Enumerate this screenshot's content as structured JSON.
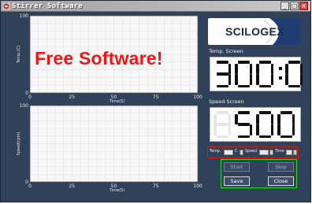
{
  "window": {
    "title": "Stirrer Software"
  },
  "titlebar": {
    "minimize_glyph": "_",
    "maximize_glyph": "□",
    "close_glyph": "×"
  },
  "watermark": "Free Software!",
  "logo": {
    "text": "SCILOGEX"
  },
  "temp_screen": {
    "label": "Temp. Screen",
    "display": "300:0"
  },
  "speed_screen": {
    "label": "Speed Screen",
    "display": "500"
  },
  "params": {
    "temp_label": "Temp.",
    "temp_unit": "C",
    "speed_label": "Speed",
    "time_label": "Time",
    "temp_value": "",
    "speed_value": "",
    "time_value": ""
  },
  "buttons": {
    "start": "Start",
    "stop": "Stop",
    "save": "Save",
    "close": "Close"
  },
  "chart_data": [
    {
      "type": "line",
      "ylabel": "Temp.(C)",
      "xlabel": "Time(S)",
      "xlim": [
        0,
        100
      ],
      "ylim": [
        0,
        100
      ],
      "x_ticks": [
        0,
        25,
        50,
        75,
        100
      ],
      "y_ticks": [
        0,
        100
      ],
      "grid": true,
      "series": []
    },
    {
      "type": "line",
      "ylabel": "Speed(rpm)",
      "xlabel": "Time(S)",
      "xlim": [
        0,
        100
      ],
      "ylim": [
        0,
        100
      ],
      "x_ticks": [
        0,
        25,
        50,
        75,
        100
      ],
      "y_ticks": [
        0,
        100
      ],
      "grid": true,
      "series": []
    }
  ]
}
